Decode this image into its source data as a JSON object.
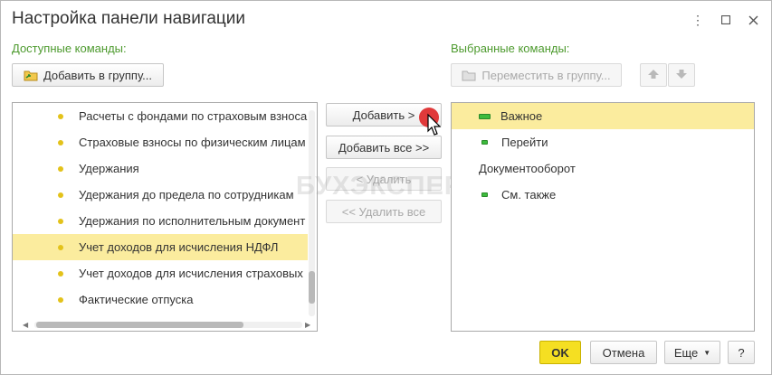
{
  "window": {
    "title": "Настройка панели навигации",
    "controls": [
      {
        "name": "more-icon",
        "glyph": "⋮"
      },
      {
        "name": "maximize-icon",
        "glyph": "☐"
      },
      {
        "name": "close-icon",
        "glyph": "✕"
      }
    ]
  },
  "available": {
    "label": "Доступные команды:",
    "add_to_group_label": "Добавить в группу...",
    "items": [
      {
        "label": "Расчеты с фондами по страховым взноса",
        "selected": false
      },
      {
        "label": "Страховые взносы по физическим лицам",
        "selected": false
      },
      {
        "label": "Удержания",
        "selected": false
      },
      {
        "label": "Удержания до предела по сотрудникам",
        "selected": false
      },
      {
        "label": "Удержания по исполнительным документ",
        "selected": false
      },
      {
        "label": "Учет доходов для исчисления НДФЛ",
        "selected": true
      },
      {
        "label": "Учет доходов для исчисления страховых",
        "selected": false
      },
      {
        "label": "Фактические отпуска",
        "selected": false
      }
    ]
  },
  "middle": {
    "add_label": "Добавить >",
    "add_all_label": "Добавить все >>",
    "remove_label": "< Удалить",
    "remove_all_label": "<< Удалить все"
  },
  "watermark": "БУХЭКСПЕРТ",
  "selected_commands": {
    "label": "Выбранные команды:",
    "move_to_group_label": "Переместить в группу...",
    "items": [
      {
        "label": "Важное",
        "kind": "group-bar",
        "selected": true
      },
      {
        "label": "Перейти",
        "kind": "item",
        "selected": false
      },
      {
        "label": "Документооборот",
        "kind": "header",
        "selected": false
      },
      {
        "label": "См. также",
        "kind": "item",
        "selected": false
      }
    ]
  },
  "footer": {
    "ok_label": "OK",
    "cancel_label": "Отмена",
    "more_label": "Еще",
    "help_label": "?"
  },
  "colors": {
    "accent_green": "#4d9a2e",
    "selection": "#fbec9e",
    "ok_button": "#f5df22",
    "bullet": "#e3c21a"
  }
}
